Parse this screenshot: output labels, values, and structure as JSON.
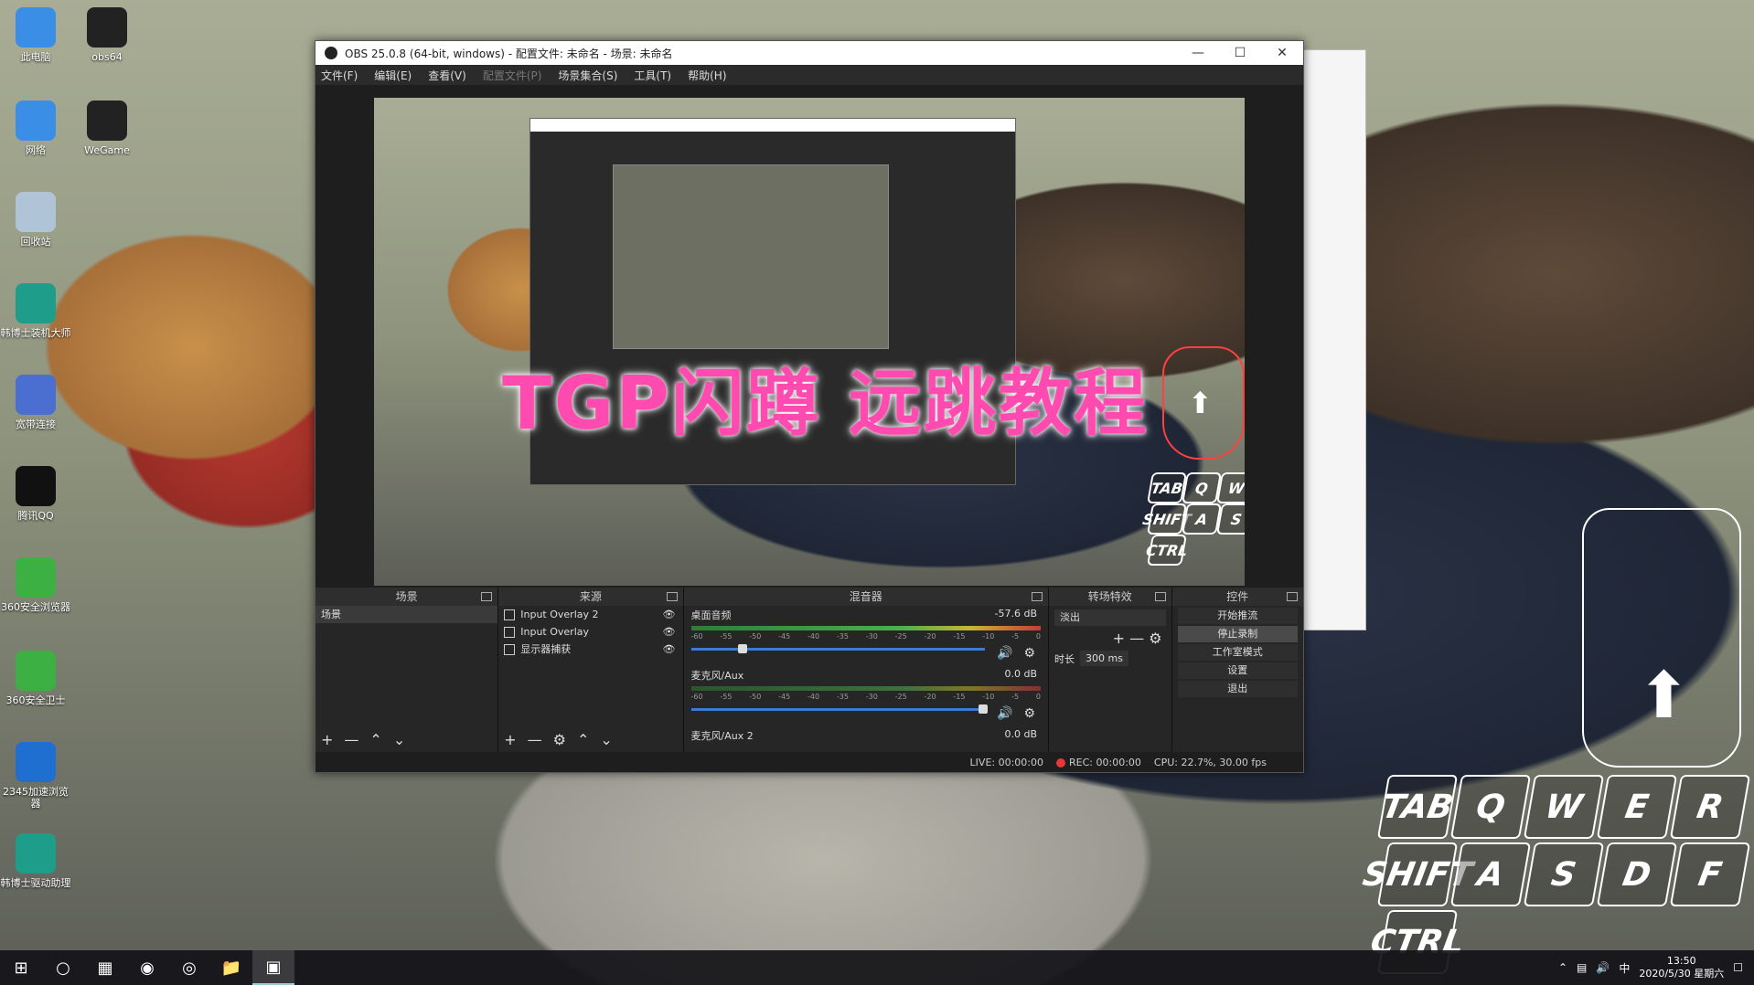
{
  "desktop": {
    "icons": [
      {
        "label": "此电脑",
        "icon": "computer-icon",
        "color": "#3a8ee6"
      },
      {
        "label": "obs64",
        "icon": "obs-icon",
        "color": "#222222"
      },
      {
        "label": "网络",
        "icon": "network-icon",
        "color": "#3a8ee6"
      },
      {
        "label": "WeGame",
        "icon": "wegame-icon",
        "color": "#222222"
      },
      {
        "label": "回收站",
        "icon": "recycle-bin-icon",
        "color": "#b0c4d8"
      },
      {
        "label": "韩博士装机大师",
        "icon": "installer-icon",
        "color": "#1e9e8a"
      },
      {
        "label": "宽带连接",
        "icon": "broadband-icon",
        "color": "#4a6fd1"
      },
      {
        "label": "腾讯QQ",
        "icon": "qq-icon",
        "color": "#111111"
      },
      {
        "label": "360安全浏览器",
        "icon": "browser-360-icon",
        "color": "#3cb043"
      },
      {
        "label": "360安全卫士",
        "icon": "shield-360-icon",
        "color": "#3cb043"
      },
      {
        "label": "2345加速浏览器",
        "icon": "browser-2345-icon",
        "color": "#1f6fd1"
      },
      {
        "label": "韩博士驱动助理",
        "icon": "driver-icon",
        "color": "#1e9e8a"
      }
    ]
  },
  "obs": {
    "title": "OBS 25.0.8 (64-bit, windows) - 配置文件: 未命名 - 场景: 未命名",
    "menu": [
      {
        "label": "文件(F)",
        "enabled": true
      },
      {
        "label": "编辑(E)",
        "enabled": true
      },
      {
        "label": "查看(V)",
        "enabled": true
      },
      {
        "label": "配置文件(P)",
        "enabled": false
      },
      {
        "label": "场景集合(S)",
        "enabled": true
      },
      {
        "label": "工具(T)",
        "enabled": true
      },
      {
        "label": "帮助(H)",
        "enabled": true
      }
    ],
    "preview_overlay_title": "TGP闪蹲 远跳教程",
    "docks": {
      "scenes": {
        "title": "场景",
        "items": [
          "场景"
        ]
      },
      "sources": {
        "title": "来源",
        "items": [
          "Input Overlay 2",
          "Input Overlay",
          "显示器捕获"
        ]
      },
      "mixer": {
        "title": "混音器",
        "channels": [
          {
            "name": "桌面音频",
            "db": "-57.6 dB"
          },
          {
            "name": "麦克风/Aux",
            "db": "0.0 dB"
          },
          {
            "name": "麦克风/Aux 2",
            "db": "0.0 dB"
          }
        ],
        "ticks": [
          "-60",
          "-55",
          "-50",
          "-45",
          "-40",
          "-35",
          "-30",
          "-25",
          "-20",
          "-15",
          "-10",
          "-5",
          "0"
        ]
      },
      "transitions": {
        "title": "转场特效",
        "selected": "淡出",
        "duration_label": "时长",
        "duration_value": "300 ms"
      },
      "controls": {
        "title": "控件",
        "buttons": [
          "开始推流",
          "停止录制",
          "工作室模式",
          "设置",
          "退出"
        ]
      }
    },
    "status": {
      "live": "LIVE: 00:00:00",
      "rec": "REC: 00:00:00",
      "cpu": "CPU: 22.7%, 30.00 fps"
    }
  },
  "keyboard_overlay": {
    "row1": [
      "TAB",
      "Q",
      "W",
      "E",
      "R"
    ],
    "row2": [
      "SHIFT",
      "A",
      "S",
      "D",
      "F"
    ],
    "row3": [
      "CTRL"
    ]
  },
  "taskbar": {
    "clock_time": "13:50",
    "clock_date": "2020/5/30 星期六",
    "ime": "中"
  }
}
